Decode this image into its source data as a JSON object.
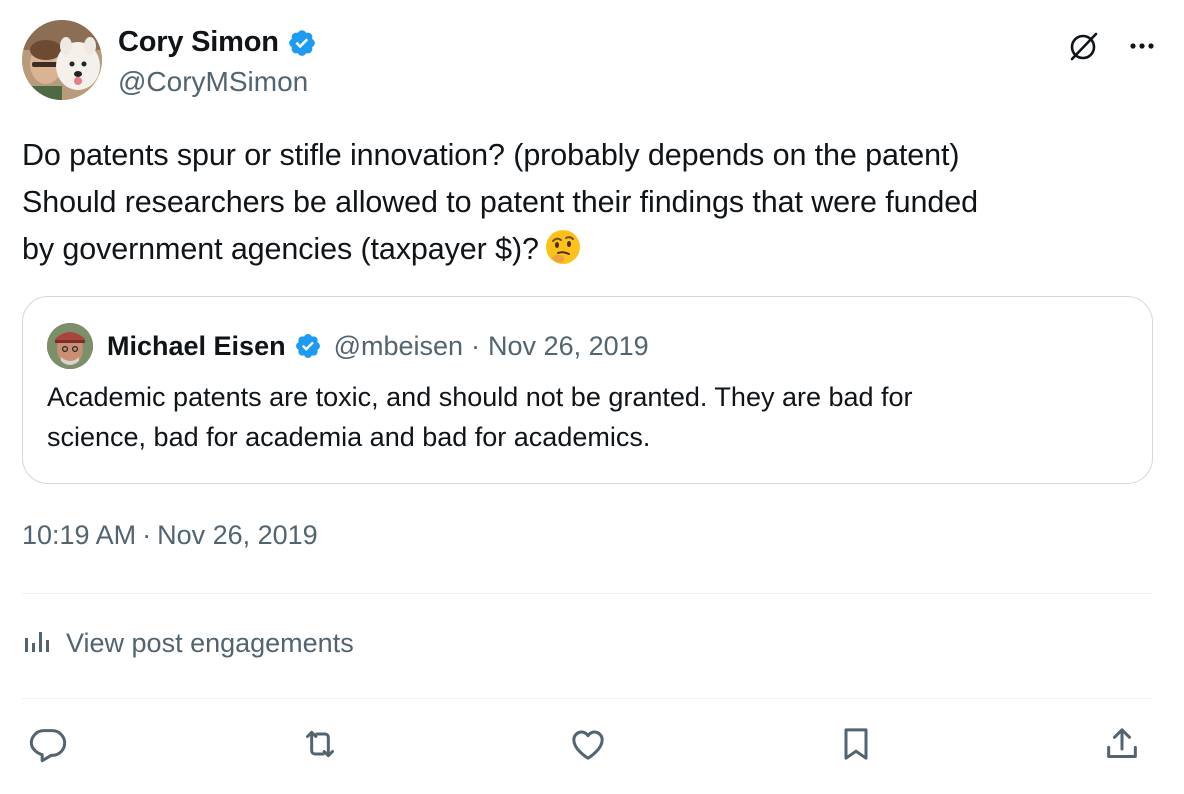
{
  "author": {
    "display_name": "Cory Simon",
    "handle": "@CoryMSimon",
    "verified": true
  },
  "post": {
    "lines": [
      "Do patents spur or stifle innovation? (probably depends on the patent)",
      "Should researchers be allowed to patent their findings that were funded",
      "by government agencies (taxpayer $)?"
    ],
    "emoji": "thinking-face"
  },
  "quote": {
    "display_name": "Michael Eisen",
    "handle": "@mbeisen",
    "separator": "·",
    "date": "Nov 26, 2019",
    "lines": [
      "Academic patents are toxic, and should not be granted. They are bad for",
      "science, bad for academia and bad for academics."
    ]
  },
  "meta": {
    "time": "10:19 AM",
    "separator": "·",
    "date": "Nov 26, 2019"
  },
  "engagements": {
    "label": "View post engagements"
  },
  "actions": {
    "icons": [
      "reply-icon",
      "repost-icon",
      "like-icon",
      "bookmark-icon",
      "share-icon"
    ]
  },
  "colors": {
    "text": "#0f1419",
    "secondary": "#536471",
    "verified": "#1d9bf0",
    "border": "#cfd9de"
  }
}
